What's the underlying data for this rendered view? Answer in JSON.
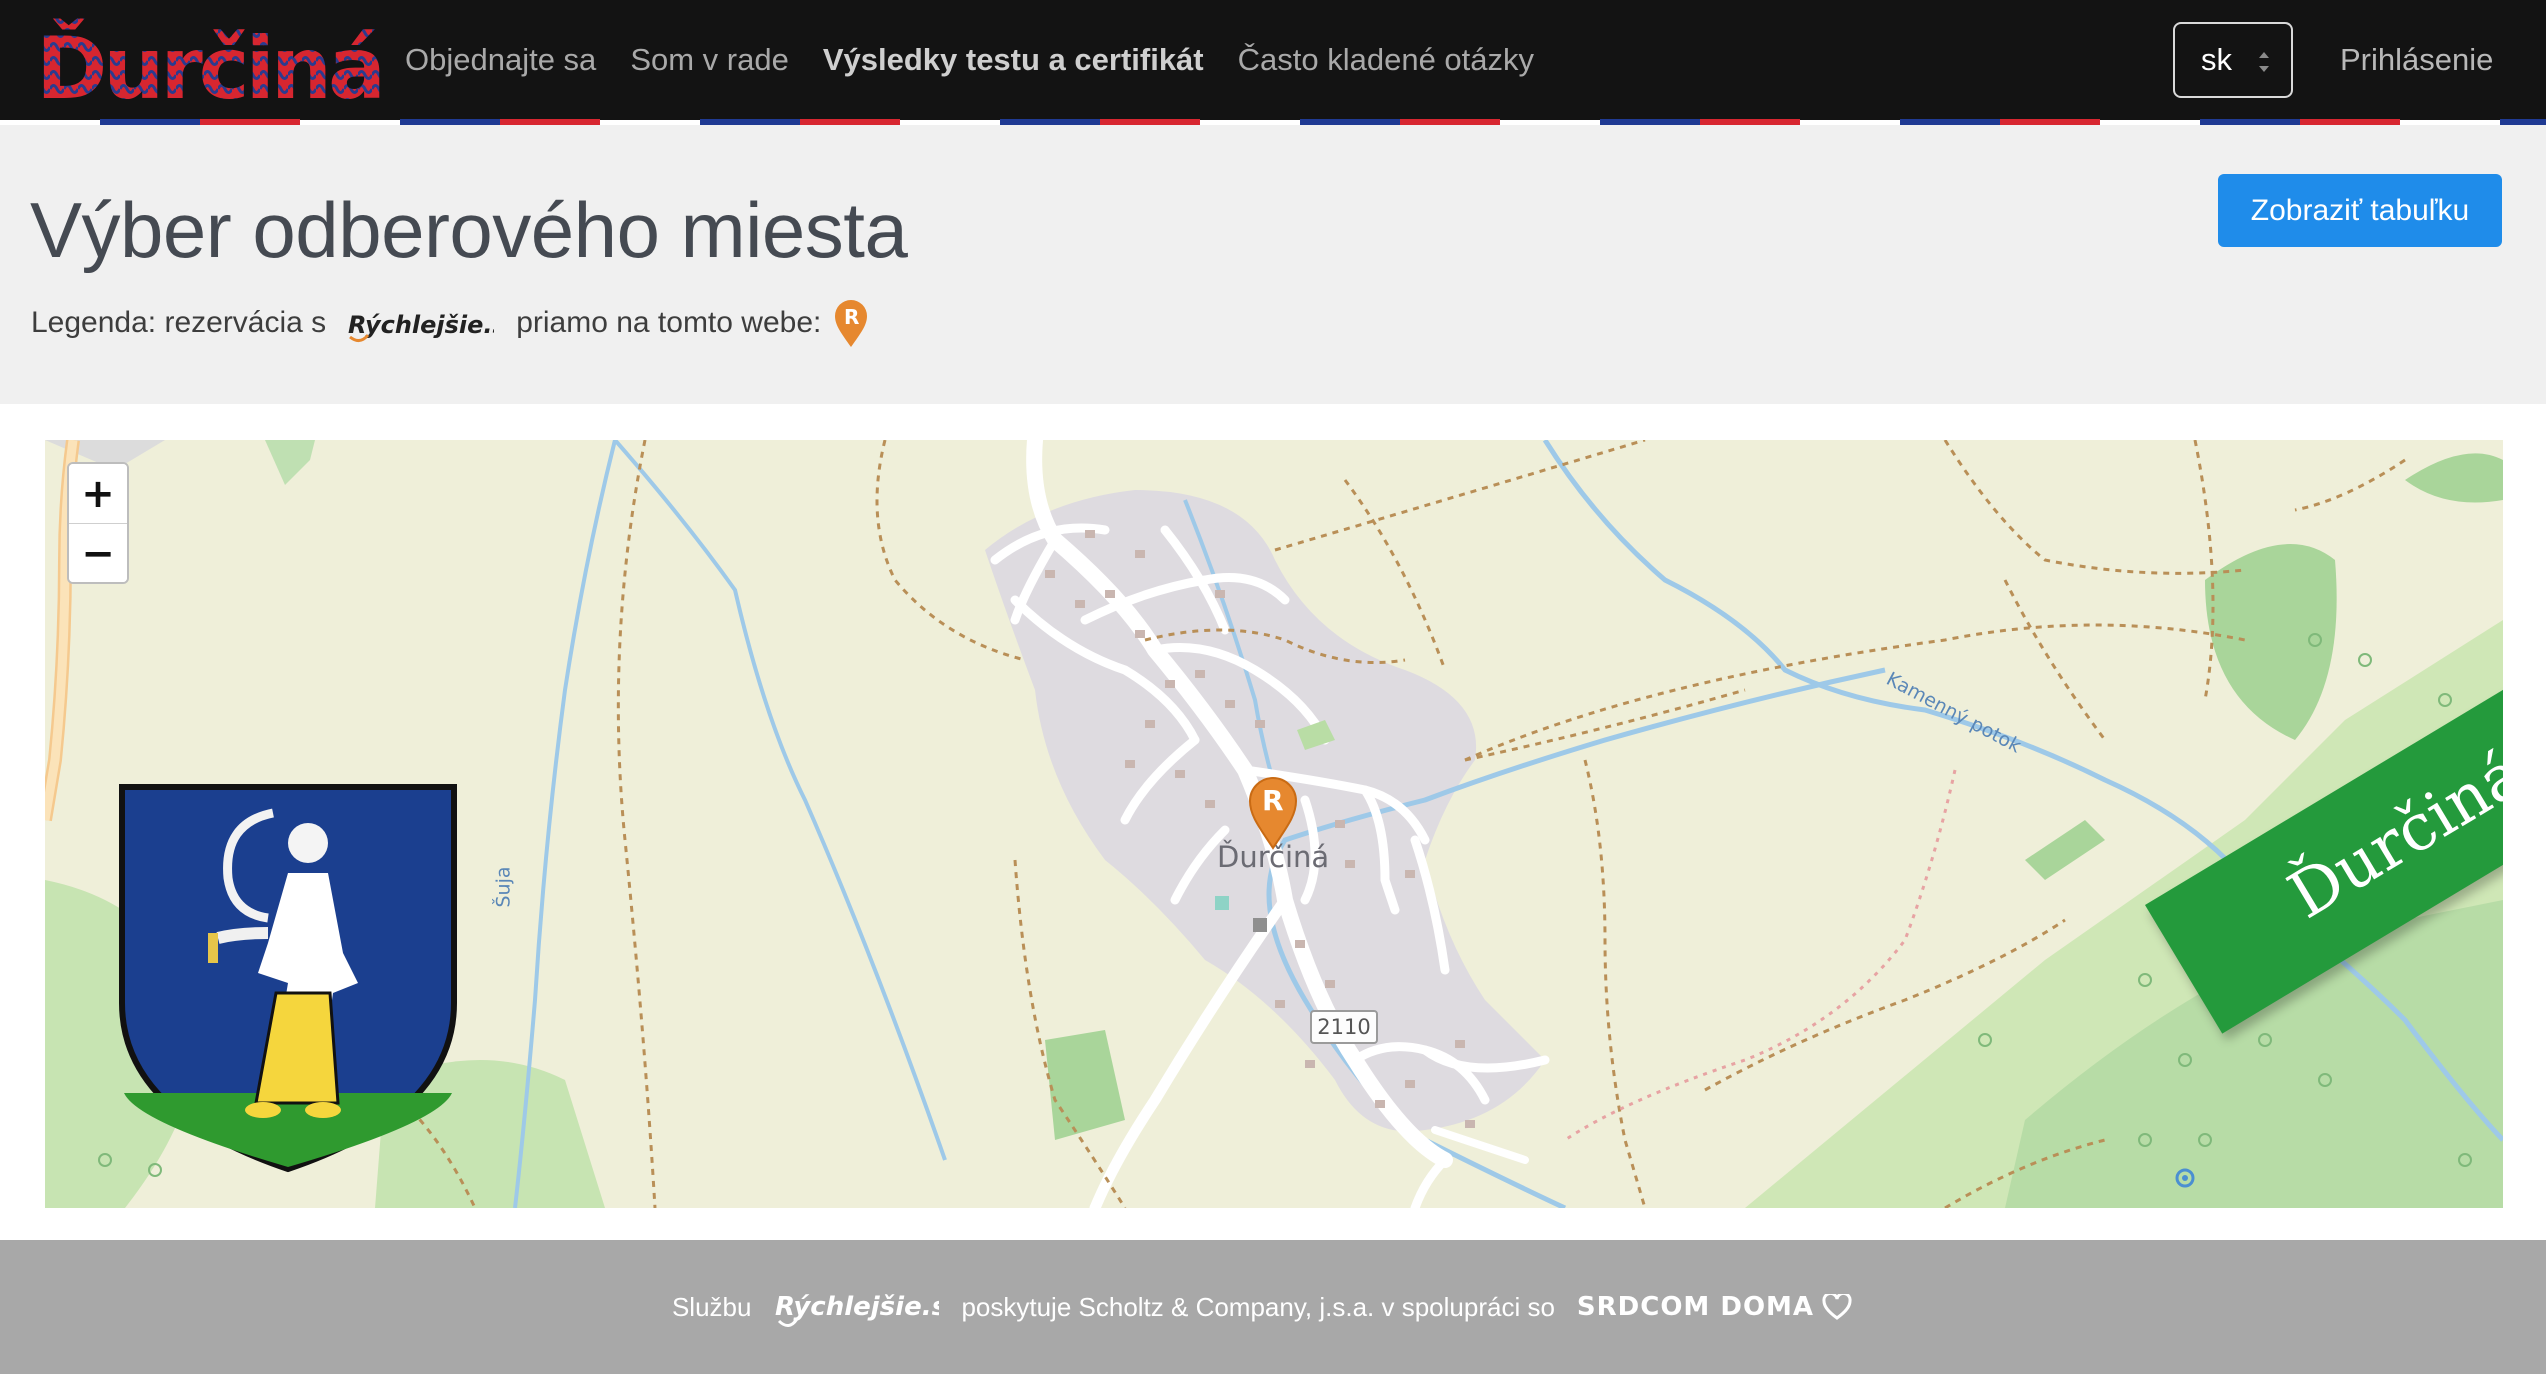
{
  "navbar": {
    "brand": "Ďurčiná",
    "links": [
      {
        "label": "Objednajte sa",
        "active": false
      },
      {
        "label": "Som v rade",
        "active": false
      },
      {
        "label": "Výsledky testu a certifikát",
        "active": true
      },
      {
        "label": "Často kladené otázky",
        "active": false
      }
    ],
    "language": "sk",
    "login": "Prihlásenie"
  },
  "header": {
    "title": "Výber odberového miesta",
    "legend_prefix": "Legenda: rezervácia s",
    "legend_logo": "Rýchlejšie.sk",
    "legend_suffix": "priamo na tomto webe:",
    "show_table_button": "Zobraziť tabuľku"
  },
  "map": {
    "zoom_in": "+",
    "zoom_out": "−",
    "village": "Ďurčiná",
    "road_number": "2110",
    "stream_label": "Kamenný potok",
    "river_label": "Šuja",
    "ribbon_text": "Ďurčiná"
  },
  "footer": {
    "prefix": "Službu",
    "logo": "Rýchlejšie.sk",
    "middle": "poskytuje Scholtz & Company, j.s.a. v spolupráci so",
    "partner": "SRDCOM DOMA"
  },
  "colors": {
    "navbar_bg": "#131313",
    "button_primary": "#1f8cea",
    "ribbon_green": "#249a3c",
    "marker_orange": "#e6882f",
    "brand_red": "#d72630"
  }
}
